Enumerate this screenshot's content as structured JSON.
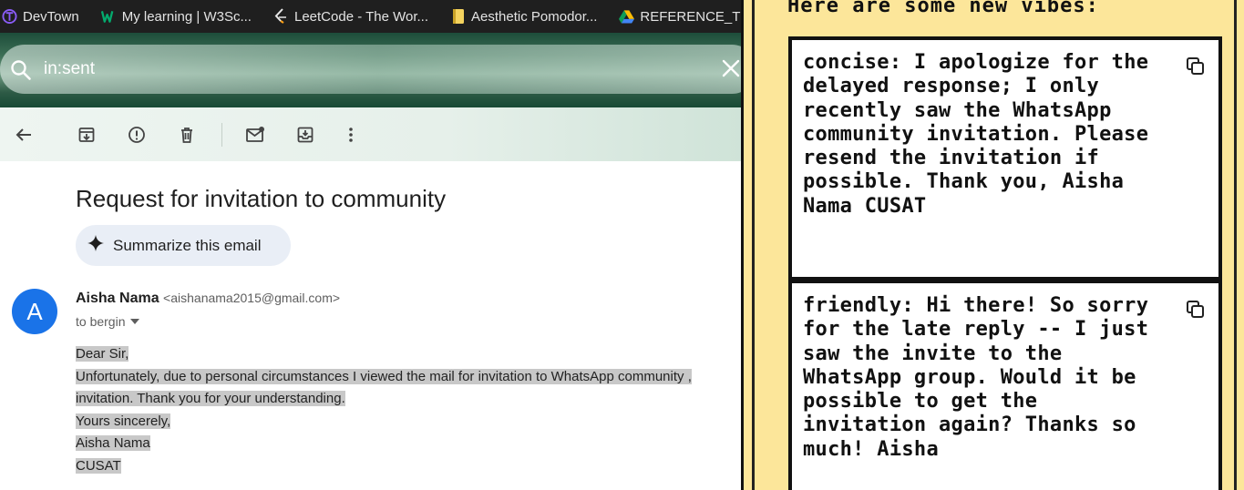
{
  "bookmarks": [
    {
      "label": "DevTown",
      "icon": "devtown-logo-icon"
    },
    {
      "label": "My learning | W3Sc...",
      "icon": "w3schools-logo-icon"
    },
    {
      "label": "LeetCode - The Wor...",
      "icon": "leetcode-logo-icon"
    },
    {
      "label": "Aesthetic Pomodor...",
      "icon": "notebook-icon"
    },
    {
      "label": "REFERENCE_TE",
      "icon": "google-drive-icon"
    }
  ],
  "search": {
    "value": "in:sent"
  },
  "toolbar": {
    "icons": [
      "back-arrow-icon",
      "archive-icon",
      "report-spam-icon",
      "delete-icon",
      "mark-unread-icon",
      "move-to-icon",
      "more-options-icon"
    ]
  },
  "email": {
    "subject": "Request for invitation to community",
    "summarize_label": "Summarize this email",
    "avatar_letter": "A",
    "sender_name": "Aisha Nama",
    "sender_email": "<aishanama2015@gmail.com>",
    "recipient": "to bergin",
    "body_lines": [
      "Dear Sir,",
      "Unfortunately, due to personal circumstances I viewed the mail for invitation to WhatsApp community ,",
      "invitation. Thank you for your understanding.",
      "Yours sincerely,",
      "Aisha Nama",
      "CUSAT"
    ]
  },
  "panel": {
    "title": "Here are some new vibes:",
    "cards": [
      {
        "label": "concise:",
        "text": "I apologize for the delayed response; I only recently saw the WhatsApp community invitation. Please resend the invitation if possible. Thank you, Aisha Nama CUSAT"
      },
      {
        "label": "friendly:",
        "text": "Hi there! So sorry for the late reply -- I just saw the invite to the WhatsApp group. Would it be possible to get the invitation again? Thanks so much! Aisha"
      }
    ]
  },
  "colors": {
    "avatar": "#1a73e8",
    "panel_bg": "#fce69a",
    "highlight": "#c8c8c8"
  }
}
